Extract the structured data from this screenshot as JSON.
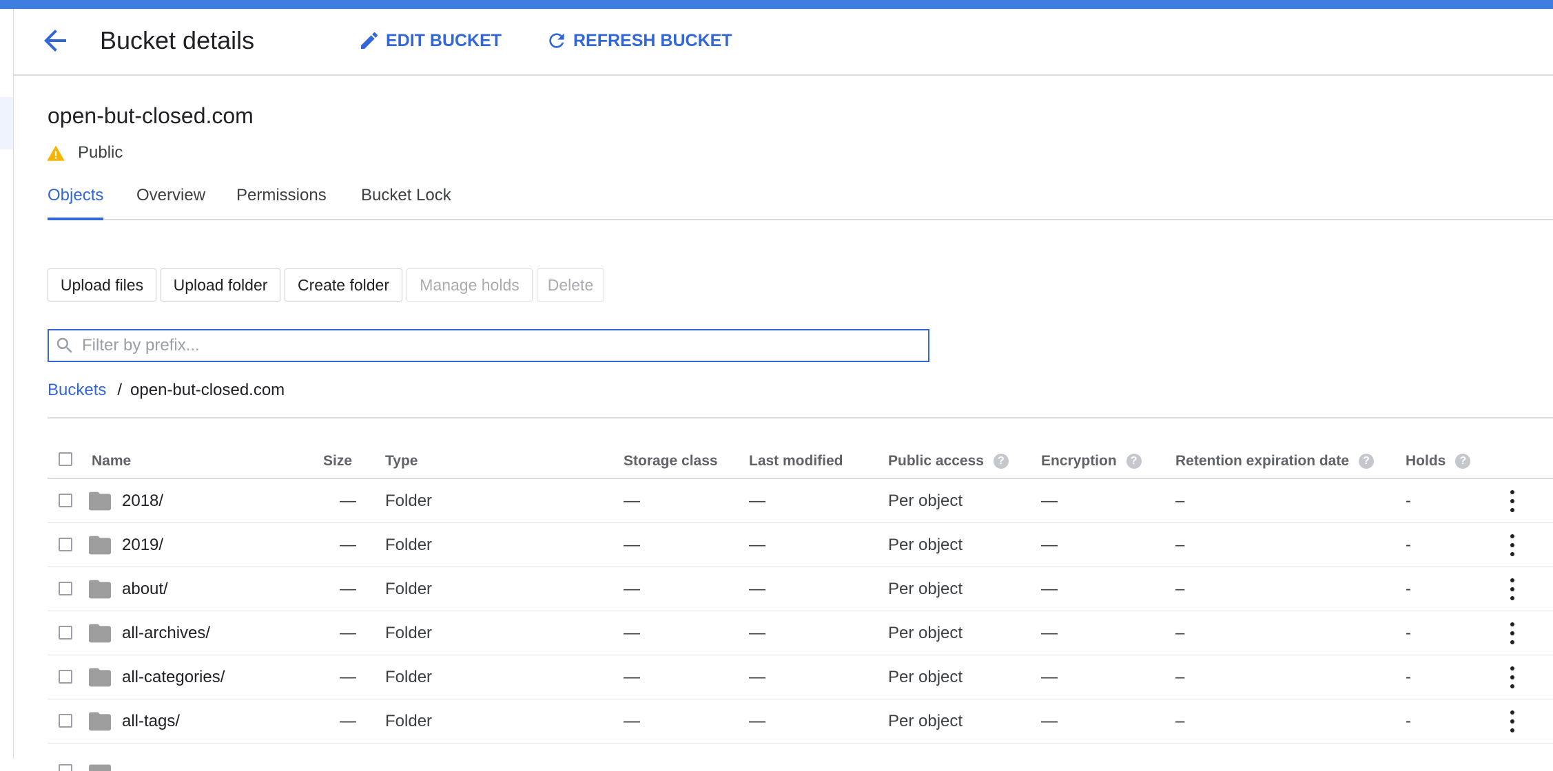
{
  "header": {
    "title": "Bucket details",
    "edit_label": "EDIT BUCKET",
    "refresh_label": "REFRESH BUCKET"
  },
  "bucket": {
    "name": "open-but-closed.com",
    "access": "Public"
  },
  "tabs": [
    {
      "label": "Objects",
      "active": true
    },
    {
      "label": "Overview",
      "active": false
    },
    {
      "label": "Permissions",
      "active": false
    },
    {
      "label": "Bucket Lock",
      "active": false
    }
  ],
  "toolbar": {
    "upload_files": "Upload files",
    "upload_folder": "Upload folder",
    "create_folder": "Create folder",
    "manage_holds": "Manage holds",
    "delete": "Delete"
  },
  "filter": {
    "placeholder": "Filter by prefix...",
    "value": ""
  },
  "breadcrumb": {
    "root": "Buckets",
    "separator": "/",
    "current": "open-but-closed.com"
  },
  "table": {
    "columns": {
      "name": "Name",
      "size": "Size",
      "type": "Type",
      "storage_class": "Storage class",
      "last_modified": "Last modified",
      "public_access": "Public access",
      "encryption": "Encryption",
      "retention": "Retention expiration date",
      "holds": "Holds"
    },
    "help_glyph": "?",
    "rows": [
      {
        "name": "2018/",
        "size": "—",
        "type": "Folder",
        "storage_class": "—",
        "last_modified": "—",
        "public_access": "Per object",
        "encryption": "—",
        "retention": "–",
        "holds": "-"
      },
      {
        "name": "2019/",
        "size": "—",
        "type": "Folder",
        "storage_class": "—",
        "last_modified": "—",
        "public_access": "Per object",
        "encryption": "—",
        "retention": "–",
        "holds": "-"
      },
      {
        "name": "about/",
        "size": "—",
        "type": "Folder",
        "storage_class": "—",
        "last_modified": "—",
        "public_access": "Per object",
        "encryption": "—",
        "retention": "–",
        "holds": "-"
      },
      {
        "name": "all-archives/",
        "size": "—",
        "type": "Folder",
        "storage_class": "—",
        "last_modified": "—",
        "public_access": "Per object",
        "encryption": "—",
        "retention": "–",
        "holds": "-"
      },
      {
        "name": "all-categories/",
        "size": "—",
        "type": "Folder",
        "storage_class": "—",
        "last_modified": "—",
        "public_access": "Per object",
        "encryption": "—",
        "retention": "–",
        "holds": "-"
      },
      {
        "name": "all-tags/",
        "size": "—",
        "type": "Folder",
        "storage_class": "—",
        "last_modified": "—",
        "public_access": "Per object",
        "encryption": "—",
        "retention": "–",
        "holds": "-"
      }
    ]
  },
  "colors": {
    "accent": "#3367d6",
    "topbar": "#3d7ee0",
    "warning": "#f4b400",
    "folder": "#9e9e9e"
  }
}
